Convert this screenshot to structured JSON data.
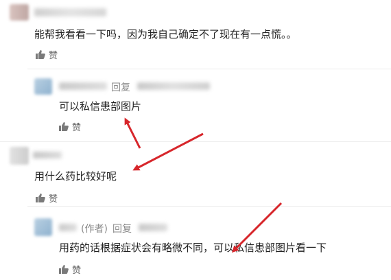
{
  "comments": [
    {
      "text": "能帮我看看一下吗，因为我自己确定不了现在有一点慌。。",
      "like": "赞"
    },
    {
      "reply_label": "回复",
      "text": "可以私信患部图片",
      "like": "赞"
    },
    {
      "text": "用什么药比较好呢",
      "like": "赞"
    },
    {
      "author_tag": "(作者)",
      "reply_label": "回复",
      "text": "用药的话根据症状会有略微不同，可以私信患部图片看一下",
      "like": "赞"
    }
  ],
  "colors": {
    "arrow": "#d7262b",
    "text": "#222222",
    "muted": "#8a8a8a"
  },
  "icons": [
    "thumbs-up-icon",
    "arrow-icon"
  ]
}
